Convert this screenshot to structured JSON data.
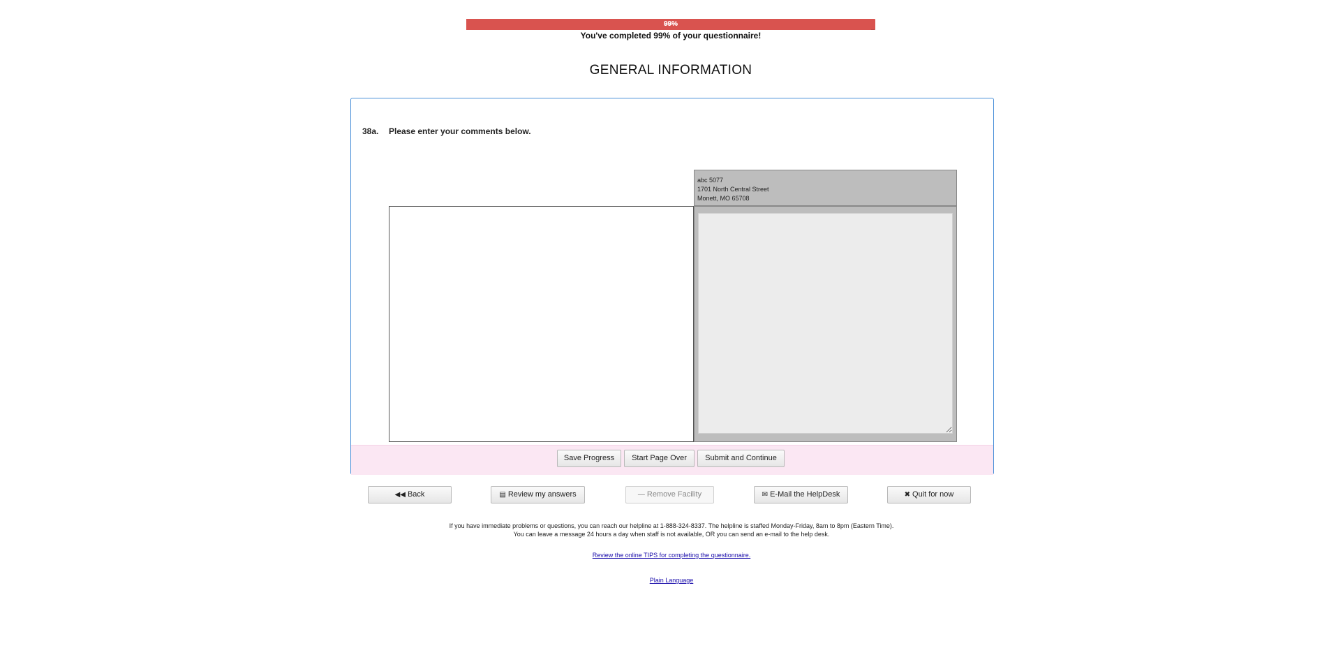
{
  "progress": {
    "percent_label": "99%",
    "value": 0.99,
    "caption": "You've completed 99% of your questionnaire!",
    "color": "#d9534f"
  },
  "page": {
    "title": "GENERAL INFORMATION"
  },
  "question": {
    "number": "38a.",
    "text": "Please enter your comments below."
  },
  "facility_address": {
    "line1": "abc 5077",
    "line2": "1701 North Central Street",
    "line3": "Monett, MO 65708"
  },
  "comment": {
    "value": "",
    "placeholder": ""
  },
  "actions": {
    "save": "Save Progress",
    "start_over": "Start Page Over",
    "submit": "Submit and Continue"
  },
  "nav": {
    "back": "Back",
    "review": "Review my answers",
    "remove": "Remove Facility",
    "email": "E-Mail the HelpDesk",
    "quit": "Quit for now"
  },
  "help": {
    "line1": "If you have immediate problems or questions, you can reach our helpline at 1-888-324-8337. The helpline is staffed Monday-Friday, 8am to 8pm (Eastern Time).",
    "line2": "You can leave a message 24 hours a day when staff is not available, OR you can send an e-mail to the help desk.",
    "tips_link": "Review the online TIPS for completing the questionnaire.",
    "plain_language_link": "Plain Language"
  },
  "colors": {
    "panel_border": "#4a90d9",
    "action_bar_bg": "#fbe7f3",
    "link": "#1a0dab"
  },
  "icons": {
    "back": "backward-icon",
    "review": "list-icon",
    "remove": "minus-icon",
    "email": "envelope-icon",
    "quit": "close-icon"
  }
}
